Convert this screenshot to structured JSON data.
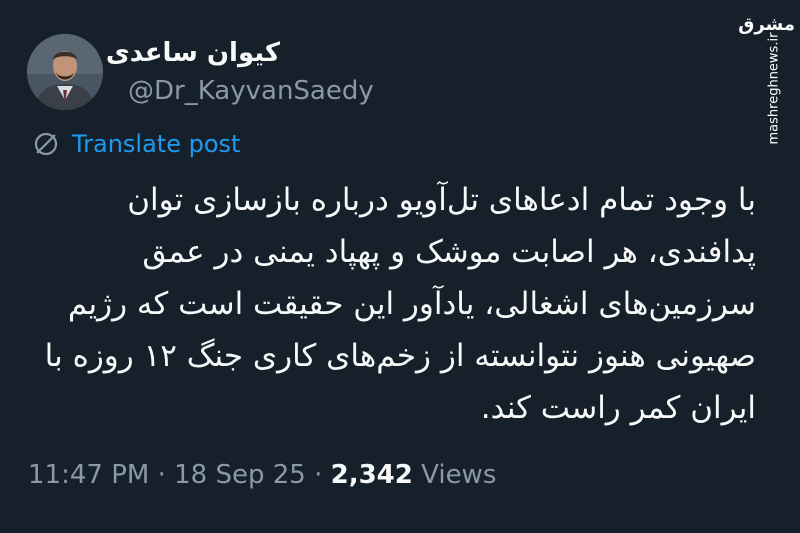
{
  "post": {
    "author": {
      "display_name": "کیوان ساعدی",
      "handle": "@Dr_KayvanSaedy"
    },
    "translate_label": "Translate post",
    "text_lines": [
      "با وجود تمام ادعاهای تل‌آویو درباره بازسازی توان",
      "پدافندی، هر اصابت موشک و پهپاد یمنی در عمق",
      "سرزمین‌های اشغالی، یادآور این حقیقت است که رژیم",
      "صهیونی هنوز نتوانسته از زخم‌های کاری جنگ ۱۲ روزه با",
      "ایران کمر راست کند."
    ],
    "time": "11:47 PM",
    "date": "18 Sep 25",
    "separator": "·",
    "views_count": "2,342",
    "views_label": "Views"
  },
  "watermark": {
    "logo_text": "مشرق",
    "site": "mashreghnews.ir"
  },
  "colors": {
    "background": "#15202b",
    "link": "#1d9bf0",
    "secondary_text": "#8b98a5",
    "primary_text": "#f7f9f9"
  },
  "icons": {
    "translate": "globe-icon",
    "avatar": "avatar-photo"
  }
}
